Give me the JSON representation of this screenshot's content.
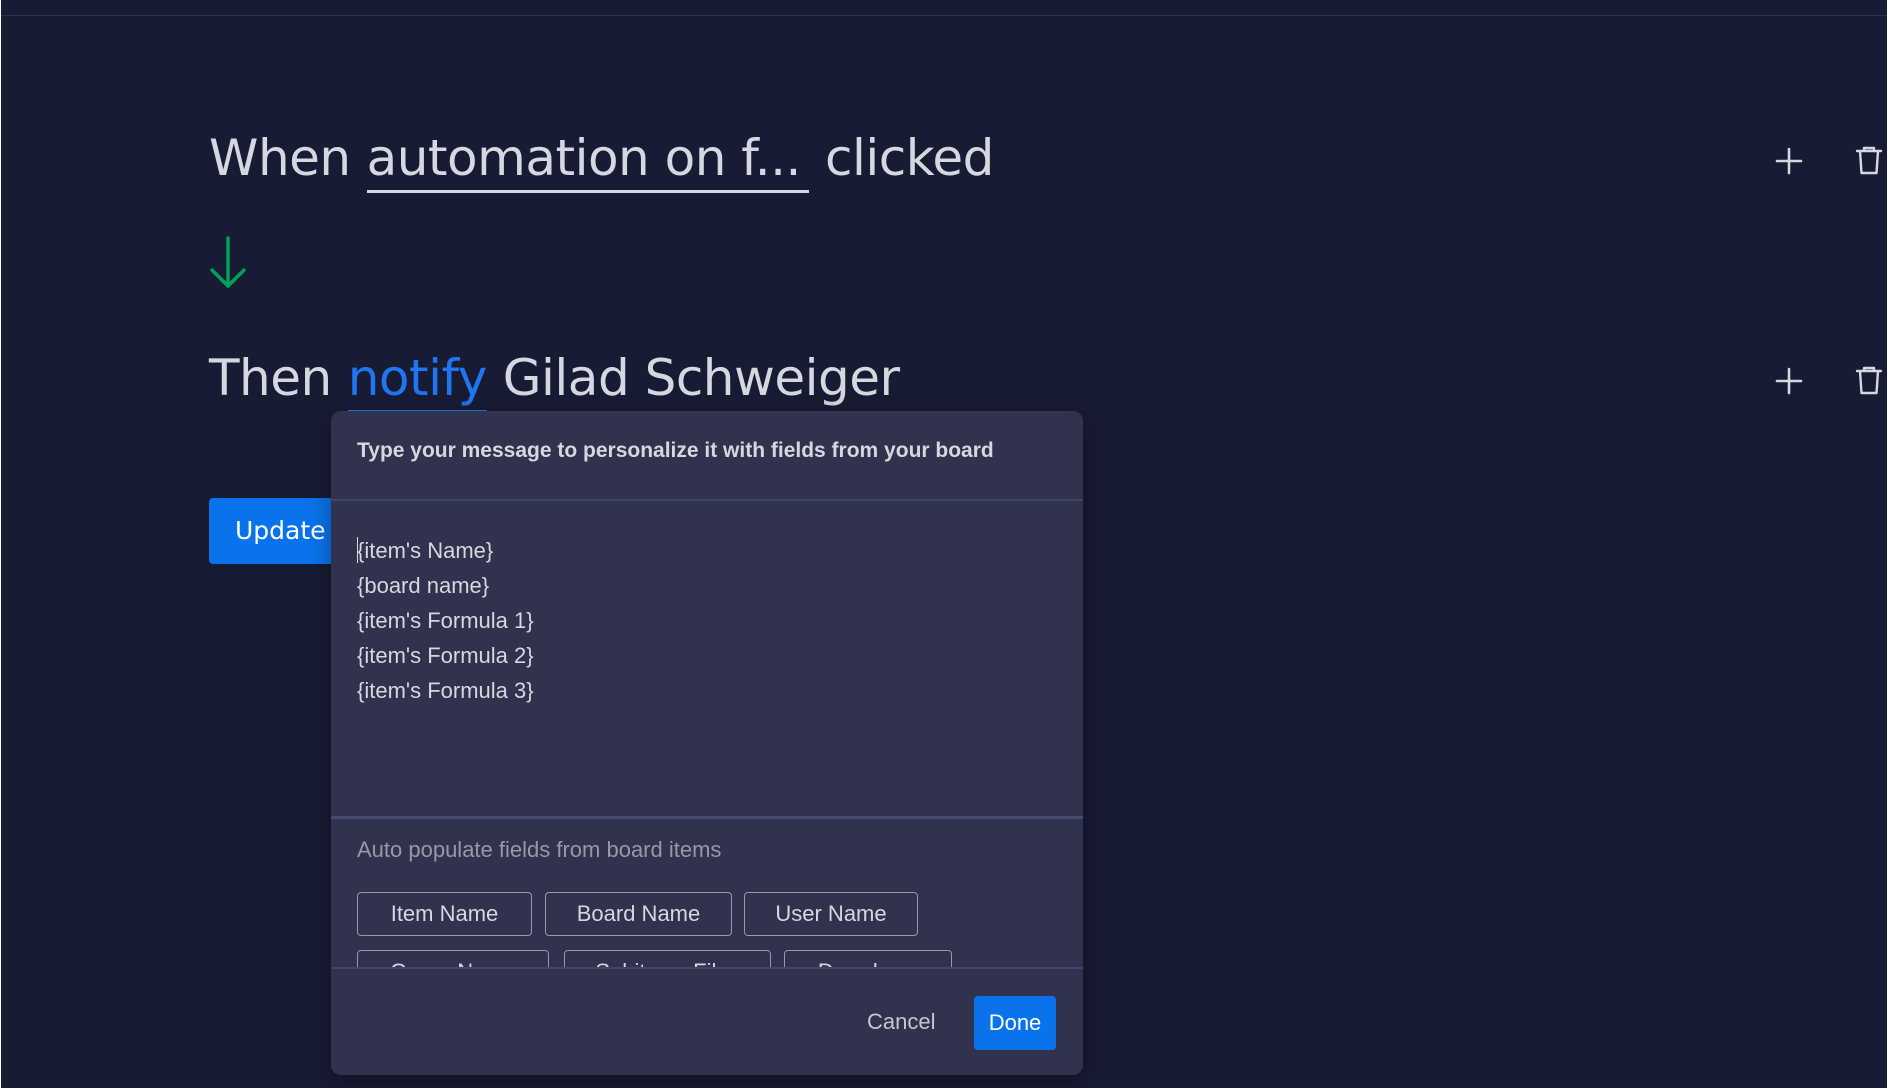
{
  "recipe": {
    "trigger": {
      "prefix": "When",
      "field": "automation on f...",
      "suffix": "clicked"
    },
    "action": {
      "prefix": "Then",
      "verb": "notify",
      "target": "Gilad Schweiger"
    },
    "update_button": "Update"
  },
  "icons": {
    "arrow": "arrow-down-icon",
    "plus": "plus-icon",
    "trash": "trash-icon"
  },
  "colors": {
    "background": "#181b34",
    "dialog": "#30324e",
    "primary": "#0a73eb",
    "arrow": "#00a35a",
    "text": "#d5d8df",
    "muted": "#9699a6"
  },
  "dialog": {
    "header": "Type your message to personalize it with fields from your board",
    "message_lines": [
      "{item's Name}",
      "{board name}",
      "{item's Formula 1}",
      "{item's Formula 2}",
      "{item's Formula 3}"
    ],
    "auto_populate_title": "Auto populate fields from board items",
    "chips": [
      "Item Name",
      "Board Name",
      "User Name",
      "Group Name",
      "Subitems Files",
      "Dropdown"
    ],
    "cancel_label": "Cancel",
    "done_label": "Done"
  }
}
